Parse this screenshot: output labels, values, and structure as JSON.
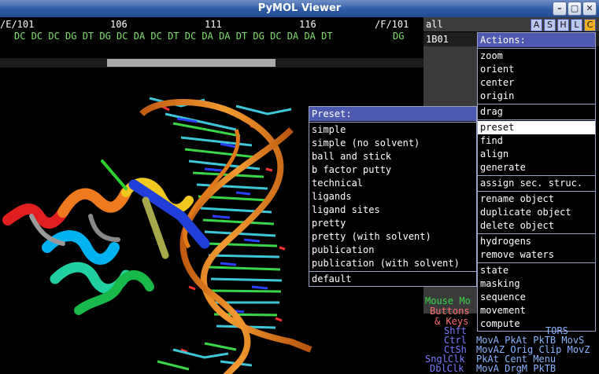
{
  "window": {
    "title": "PyMOL Viewer",
    "btn_min": "–",
    "btn_max": "▢",
    "btn_close": "✕"
  },
  "sequence": {
    "idx_start": "/E/101",
    "idx_106": "106",
    "idx_111": "111",
    "idx_116": "116",
    "idx_end": "/F/101",
    "residues": "DC DC DC DG DT DG DC DA DC DT DC DA DA DT DG DC DA DA DT",
    "last_residue": "DG"
  },
  "objects": {
    "header": "all",
    "buttons": [
      "A",
      "S",
      "H",
      "L",
      "C"
    ],
    "items": [
      "1B01"
    ]
  },
  "actions_menu": {
    "title": "Actions:",
    "groups": [
      [
        "zoom",
        "orient",
        "center",
        "origin"
      ],
      [
        "drag"
      ],
      [
        "preset",
        "find",
        "align",
        "generate"
      ],
      [
        "assign sec. struc."
      ],
      [
        "rename object",
        "duplicate object",
        "delete object"
      ],
      [
        "hydrogens",
        "remove waters"
      ],
      [
        "state",
        "masking",
        "sequence",
        "movement",
        "compute"
      ]
    ],
    "selected": "preset"
  },
  "preset_menu": {
    "title": "Preset:",
    "items": [
      "simple",
      "simple (no solvent)",
      "ball and stick",
      "b factor putty",
      "technical",
      "ligands",
      "ligand sites",
      "pretty",
      "pretty (with solvent)",
      "publication",
      "publication (with solvent)"
    ],
    "default": "default"
  },
  "mouse_help": {
    "mode": "Mouse Mo",
    "buttons": "Buttons",
    "keys": "& Keys",
    "shft_label": "Shft",
    "shft": "TORS",
    "ctrl_label": "Ctrl",
    "ctrl": "MovA PkAt PkTB MovS",
    "ctsh_label": "CtSh",
    "ctsh": "MovAZ Orig Clip MovZ",
    "snglclk_label": "SnglClk",
    "snglclk": "PkAt Cent Menu",
    "dblclk_label": "DblClk",
    "dblclk": "MovA DrgM PkTB"
  },
  "colors": {
    "title_bar": "#2d5aa4",
    "menu_header": "#4d5ab0",
    "sequence_residue": "#7ee06a",
    "sequence_last": "#46c8f0"
  }
}
